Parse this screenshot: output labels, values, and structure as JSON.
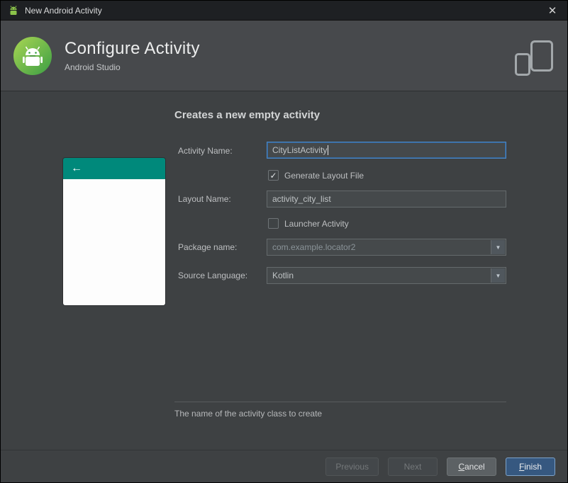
{
  "window": {
    "title": "New Android Activity"
  },
  "icons": {
    "close": "✕",
    "check": "✓",
    "back": "←",
    "dropdown": "▼",
    "app_icon": "android-icon",
    "logo": "android-studio-logo",
    "device": "phone-tablet-icon"
  },
  "header": {
    "title": "Configure Activity",
    "subtitle": "Android Studio"
  },
  "main": {
    "heading": "Creates a new empty activity",
    "help_text": "The name of the activity class to create"
  },
  "form": {
    "activity_name": {
      "label": "Activity Name:",
      "value": "CityListActivity",
      "focused": true
    },
    "generate_layout": {
      "label": "Generate Layout File",
      "checked": true
    },
    "layout_name": {
      "label": "Layout Name:",
      "value": "activity_city_list"
    },
    "launcher_activity": {
      "label": "Launcher Activity",
      "checked": false
    },
    "package_name": {
      "label": "Package name:",
      "value": "com.example.locator2"
    },
    "source_language": {
      "label": "Source Language:",
      "value": "Kotlin"
    }
  },
  "footer": {
    "previous": "Previous",
    "next": "Next",
    "cancel": "Cancel",
    "finish": "Finish"
  },
  "colors": {
    "teal_accent": "#00897b",
    "focus_blue": "#4a88c7",
    "finish_blue": "#365880",
    "header_bg": "#47494c",
    "body_bg": "#3e4143",
    "titlebar_bg": "#1e2023"
  }
}
